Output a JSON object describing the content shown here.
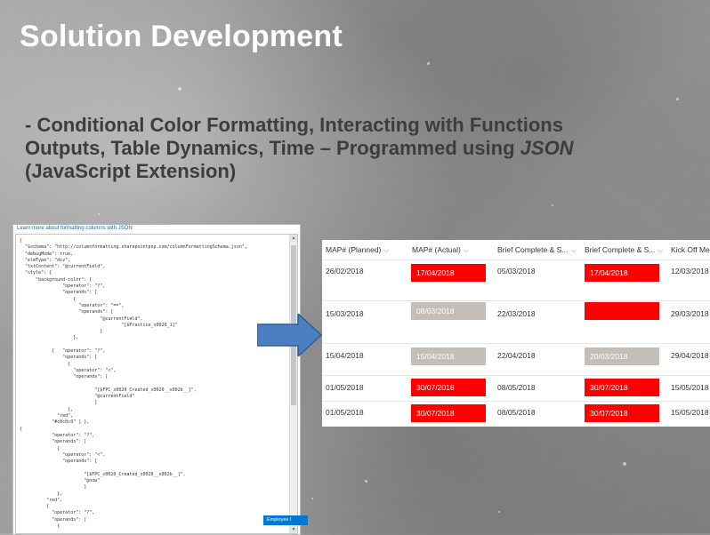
{
  "slide": {
    "title": "Solution Development",
    "subtitle_line1": "- Conditional Color Formatting, Interacting with Functions",
    "subtitle_line2a": "Outputs, Table Dynamics, Time – Programmed using ",
    "subtitle_line2b": "JSON",
    "subtitle_line3": "(JavaScript Extension)"
  },
  "editor": {
    "link_text": "Learn more about formatting columns with JSON",
    "code": "{\n  \"$schema\": \"http://columnformatting.sharepointpnp.com/columnFormattingSchema.json\",\n  \"debugMode\": true,\n  \"elmType\": \"div\",\n  \"txtContent\": \"@currentField\",\n  \"style\": {\n      \"background-color\": {\n                \"operator\": \"?\",\n                \"operands\": [\n                    {\n                      \"operator\": \"==\",\n                      \"operands\": [\n                              \"@currentField\",\n                                      \"[$Practice_x0020_1]\"\n                              ]\n                    },\n\n            {   \"operator\": \"?\",\n                \"operands\": [\n                  {\n                    \"operator\": \"<\",\n                    \"operands\": [\n\n                            \"[$FPC_x0020_Created_x0020__x002b__]\",\n                            \"@currentField\"\n                            ]\n                  },\n              \"red\",\n            \"#c0c0c0\" ] },\n{\n            \"operator\": \"?\",\n            \"operands\": [\n              {\n                \"operator\": \"<\",\n                \"operands\": [\n\n                        \"[$FPC_x0020_Created_x0020__x002b__]\",\n                        \"@now\"\n                        ]\n              },\n          \"red\",\n          {\n            \"operator\": \"?\",\n            \"operands\": [\n              {",
    "badge_label": "Employee I",
    "badge_color": "#0078d4"
  },
  "table": {
    "headers": [
      "MAP# (Planned)",
      "MAP# (Actual)",
      "Brief Complete & S...",
      "Brief Complete & S...",
      "Kick Off Mee"
    ],
    "rows": [
      [
        "26/02/2018",
        "17/04/2018",
        "05/03/2018",
        "17/04/2018",
        "12/03/2018"
      ],
      [
        "15/03/2018",
        "08/03/2018",
        "22/03/2018",
        "",
        "29/03/2018"
      ],
      [
        "15/04/2018",
        "15/04/2018",
        "22/04/2018",
        "20/03/2018",
        "29/04/2018"
      ],
      [
        "01/05/2018",
        "30/07/2018",
        "08/05/2018",
        "30/07/2018",
        "15/05/2018"
      ],
      [
        "01/05/2018",
        "30/07/2018",
        "08/05/2018",
        "30/07/2018",
        "15/05/2018"
      ]
    ],
    "actual_colors": [
      "red",
      "grey",
      "grey",
      "red",
      "red"
    ],
    "brief_colors": [
      "red",
      "red",
      "grey",
      "red",
      "red"
    ],
    "colors": {
      "red": "#ff0000",
      "grey": "#c3beb7"
    }
  },
  "arrow_color": "#4a7fc1"
}
